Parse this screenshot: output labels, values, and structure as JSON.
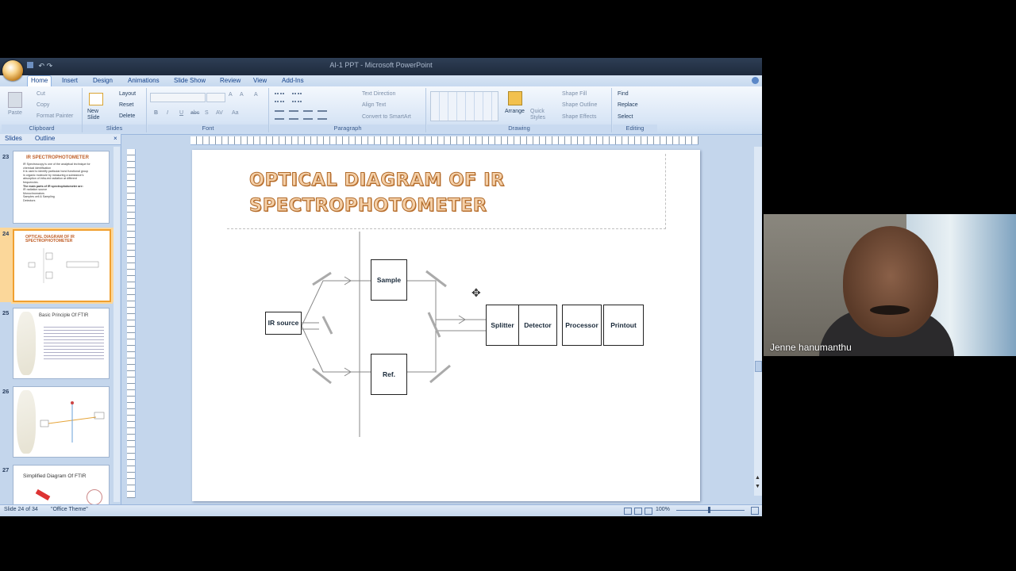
{
  "window": {
    "title": "AI-1 PPT - Microsoft PowerPoint"
  },
  "tabs": [
    {
      "label": "Home",
      "active": true
    },
    {
      "label": "Insert"
    },
    {
      "label": "Design"
    },
    {
      "label": "Animations"
    },
    {
      "label": "Slide Show"
    },
    {
      "label": "Review"
    },
    {
      "label": "View"
    },
    {
      "label": "Add-Ins"
    }
  ],
  "ribbon": {
    "clipboard": {
      "paste": "Paste",
      "cut": "Cut",
      "copy": "Copy",
      "format_painter": "Format Painter",
      "label": "Clipboard"
    },
    "slides": {
      "new_slide": "New Slide",
      "layout": "Layout",
      "reset": "Reset",
      "delete": "Delete",
      "label": "Slides"
    },
    "font": {
      "bold": "B",
      "italic": "I",
      "underline": "U",
      "strike": "abc",
      "shadow": "S",
      "spacing": "AV",
      "case": "Aa",
      "grow": "A",
      "shrink": "A",
      "clear": "A",
      "label": "Font"
    },
    "paragraph": {
      "text_direction": "Text Direction",
      "align_text": "Align Text",
      "smartart": "Convert to SmartArt",
      "label": "Paragraph"
    },
    "drawing": {
      "arrange": "Arrange",
      "quick_styles": "Quick Styles",
      "shape_fill": "Shape Fill",
      "shape_outline": "Shape Outline",
      "shape_effects": "Shape Effects",
      "label": "Drawing"
    },
    "editing": {
      "find": "Find",
      "replace": "Replace",
      "select": "Select",
      "label": "Editing"
    }
  },
  "panel": {
    "tabs": [
      "Slides",
      "Outline"
    ],
    "thumbnails": [
      {
        "num": "23",
        "title": "IR SPECTROPHOTOMETER",
        "lines": [
          "IR Spectroscopy is one of the analytical technique for",
          "chemical identification",
          "It is used to identify particular bond functional group",
          "in organic molecule by measuring a substance's",
          "absorption of infra-red radiation at different",
          "frequencies.",
          "The main parts of IR spectrophotometer are:",
          "IR radiation source",
          "Monochromators",
          "Samples cell & Sampling",
          "Detectors"
        ]
      },
      {
        "num": "24",
        "title": "OPTICAL DIAGRAM OF IR SPECTROPHOTOMETER",
        "selected": true
      },
      {
        "num": "25",
        "title": "Basic Principle Of FTIR"
      },
      {
        "num": "26",
        "title": ""
      },
      {
        "num": "27",
        "title": "Simplified Diagram Of FTIR"
      }
    ]
  },
  "slide": {
    "title_line1": "OPTICAL DIAGRAM OF IR",
    "title_line2": "SPECTROPHOTOMETER",
    "boxes": {
      "ir_source": "IR source",
      "sample": "Sample",
      "ref": "Ref.",
      "splitter": "Splitter",
      "detector": "Detector",
      "processor": "Processor",
      "printout": "Printout"
    }
  },
  "status": {
    "slide": "Slide 24 of 34",
    "theme": "\"Office Theme\"",
    "zoom": "100%"
  },
  "webcam": {
    "name": "Jenne hanumanthu"
  }
}
